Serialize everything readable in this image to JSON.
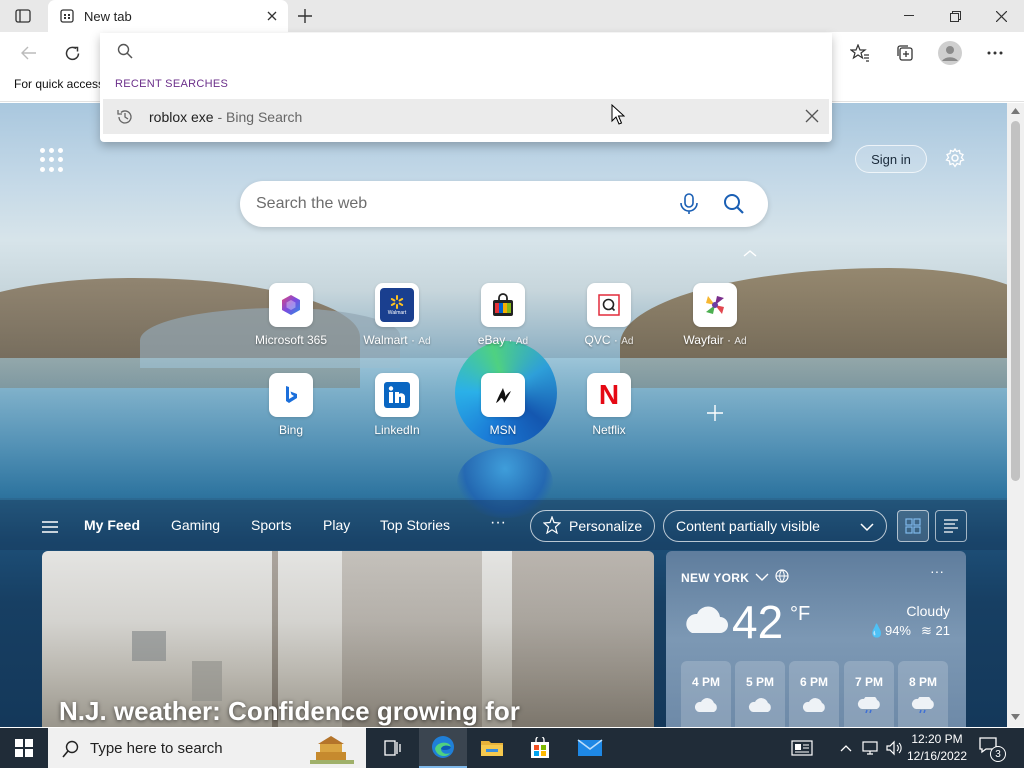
{
  "browser": {
    "tab_title": "New tab",
    "favorites_hint": "For quick access"
  },
  "dropdown": {
    "section_label": "RECENT SEARCHES",
    "items": [
      {
        "query": "roblox exe",
        "source": " - Bing Search"
      }
    ]
  },
  "ntp": {
    "signin_label": "Sign in",
    "search_placeholder": "Search the web",
    "tiles": [
      {
        "label": "Microsoft 365",
        "ad": "",
        "icon": "microsoft-365-icon"
      },
      {
        "label": "Walmart",
        "ad": "Ad",
        "icon": "walmart-icon",
        "icon_text": "Walmart"
      },
      {
        "label": "eBay",
        "ad": "Ad",
        "icon": "ebay-icon"
      },
      {
        "label": "QVC",
        "ad": "Ad",
        "icon": "qvc-icon"
      },
      {
        "label": "Wayfair",
        "ad": "Ad",
        "icon": "wayfair-icon"
      },
      {
        "label": "Bing",
        "ad": "",
        "icon": "bing-icon"
      },
      {
        "label": "LinkedIn",
        "ad": "",
        "icon": "linkedin-icon"
      },
      {
        "label": "MSN",
        "ad": "",
        "icon": "msn-icon"
      },
      {
        "label": "Netflix",
        "ad": "",
        "icon": "netflix-icon",
        "icon_text": "N"
      }
    ],
    "feed_tabs": [
      "My Feed",
      "Gaming",
      "Sports",
      "Play",
      "Top Stories"
    ],
    "more_label": "···",
    "personalize_label": "Personalize",
    "content_visibility": "Content partially visible",
    "news_headline": "N.J. weather: Confidence growing for",
    "weather": {
      "location": "NEW YORK",
      "more_label": "···",
      "temperature": "42",
      "unit": "°F",
      "condition": "Cloudy",
      "humidity": "94%",
      "wind": "21",
      "hours": [
        "4 PM",
        "5 PM",
        "6 PM",
        "7 PM",
        "8 PM"
      ]
    }
  },
  "taskbar": {
    "search_placeholder": "Type here to search",
    "time": "12:20 PM",
    "date": "12/16/2022",
    "notification_count": "3"
  },
  "colors": {
    "accent": "#0078d4",
    "recent_label": "#6b2f8a",
    "taskbar": "#202c38"
  }
}
